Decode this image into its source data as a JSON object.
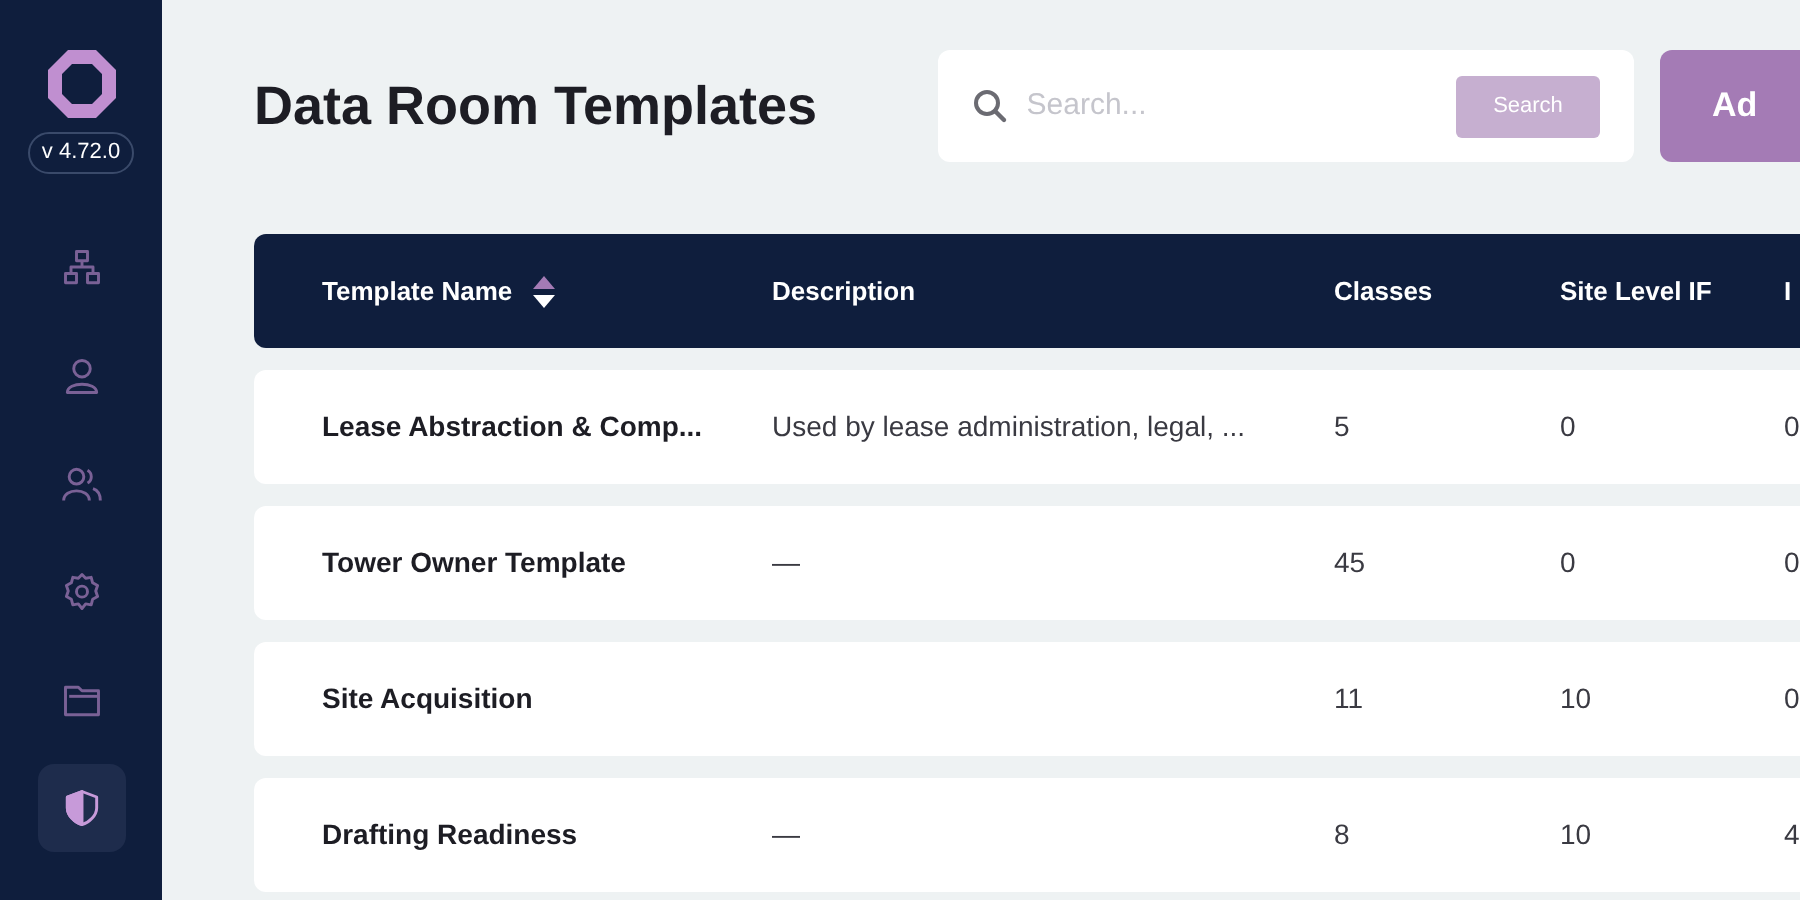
{
  "sidebar": {
    "version": "v 4.72.0",
    "items": [
      {
        "kind": "hierarchy",
        "selected": false
      },
      {
        "kind": "user",
        "selected": false
      },
      {
        "kind": "users",
        "selected": false
      },
      {
        "kind": "settings",
        "selected": false
      },
      {
        "kind": "folder",
        "selected": false
      },
      {
        "kind": "contrast",
        "selected": true
      }
    ]
  },
  "page_title": "Data Room Templates",
  "search": {
    "placeholder": "Search...",
    "button": "Search"
  },
  "add_button": "Ad",
  "table": {
    "columns": [
      {
        "label": "Template Name",
        "sort_descending": true
      },
      {
        "label": "Description"
      },
      {
        "label": "Classes"
      },
      {
        "label": "Site Level IF"
      },
      {
        "label": "I"
      }
    ],
    "rows": [
      [
        "Lease Abstraction & Comp...",
        "Used by lease administration, legal, ...",
        "5",
        "0",
        "0"
      ],
      [
        "Tower Owner Template",
        "—",
        "45",
        "0",
        "0"
      ],
      [
        "Site Acquisition",
        "",
        "11",
        "10",
        "0"
      ],
      [
        "Drafting Readiness",
        "—",
        "8",
        "10",
        "4"
      ]
    ]
  }
}
